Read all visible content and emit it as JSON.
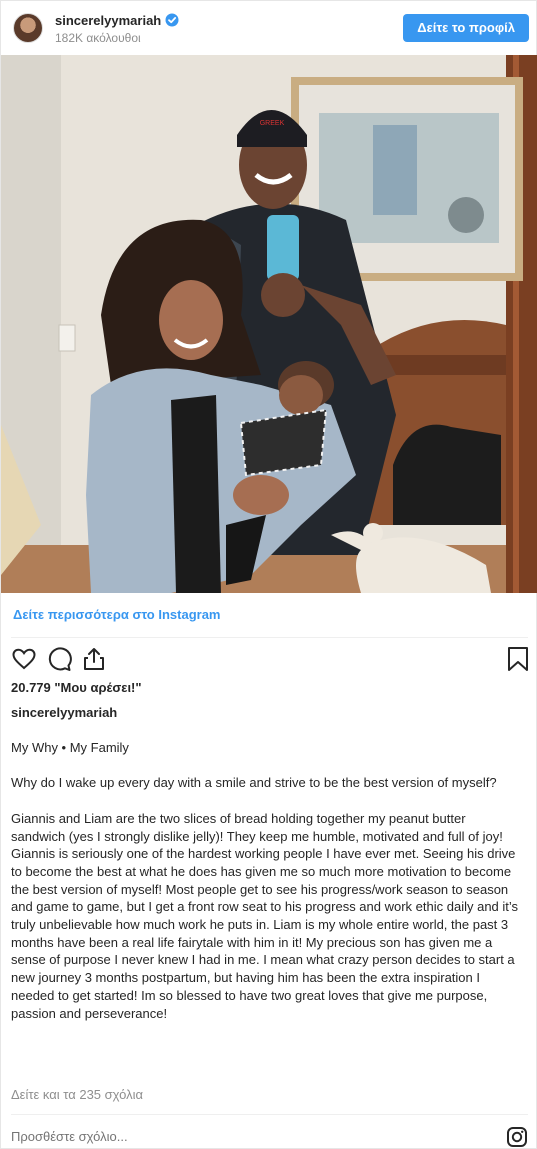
{
  "header": {
    "username": "sincerelyymariah",
    "followers": "182K ακόλουθοι",
    "profile_button": "Δείτε το προφίλ",
    "verified_icon": "verified-badge-icon",
    "avatar": "avatar"
  },
  "photo": {
    "description_icon": "instagram-photo",
    "cap_text": "GREEK"
  },
  "see_more": "Δείτε περισσότερα στο Instagram",
  "actions": {
    "like_icon": "heart-icon",
    "comment_icon": "comment-icon",
    "share_icon": "share-icon",
    "save_icon": "bookmark-icon"
  },
  "likes": "20.779 \"Μου αρέσει!\"",
  "owner": "sincerelyymariah",
  "caption": {
    "line1": "My Why • My Family",
    "line2": "Why do I wake up every day with a smile and strive to be the best version of myself?",
    "line3": "Giannis and Liam are the two slices of bread holding together my peanut butter sandwich (yes I strongly dislike jelly)! They keep me humble, motivated and full of joy! Giannis is seriously one of the hardest working people I have ever met. Seeing his drive to become the best at what he does has given me so much more motivation to become the best version of myself! Most people get to see his progress/work season to season and game to game, but I get a front row seat to his progress and work ethic daily and it’s truly unbelievable how much work he puts in. Liam is my whole entire world, the past 3 months have been a real life fairytale with him in it! My precious son has given me a sense of purpose I never knew I had in me. I mean what crazy person decides to start a new journey 3 months postpartum, but having him has been the extra inspiration I needed to get started! Im so blessed to have two great loves that give me purpose, passion and perseverance!"
  },
  "comments_link": "Δείτε και τα 235 σχόλια",
  "comment_placeholder": "Προσθέστε σχόλιο...",
  "colors": {
    "accent": "#3897f0",
    "text": "#262626",
    "muted": "#8e8e8e"
  }
}
